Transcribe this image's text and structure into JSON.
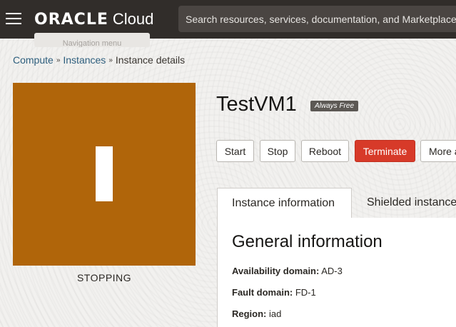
{
  "header": {
    "brand_oracle": "ORACLE",
    "brand_cloud": "Cloud",
    "search_placeholder": "Search resources, services, documentation, and Marketplace",
    "menu_tooltip": "Navigation menu"
  },
  "breadcrumb": {
    "items": [
      "Compute",
      "Instances",
      "Instance details"
    ]
  },
  "instance": {
    "avatar_letter": "I",
    "status": "STOPPING",
    "name": "TestVM1",
    "badge": "Always Free",
    "accent_color": "#b0650a"
  },
  "actions": {
    "start": "Start",
    "stop": "Stop",
    "reboot": "Reboot",
    "terminate": "Terminate",
    "more": "More actions"
  },
  "tabs": [
    "Instance information",
    "Shielded instance"
  ],
  "general": {
    "title": "General information",
    "fields": [
      {
        "label": "Availability domain:",
        "value": "AD-3"
      },
      {
        "label": "Fault domain:",
        "value": "FD-1"
      },
      {
        "label": "Region:",
        "value": "iad"
      }
    ]
  }
}
